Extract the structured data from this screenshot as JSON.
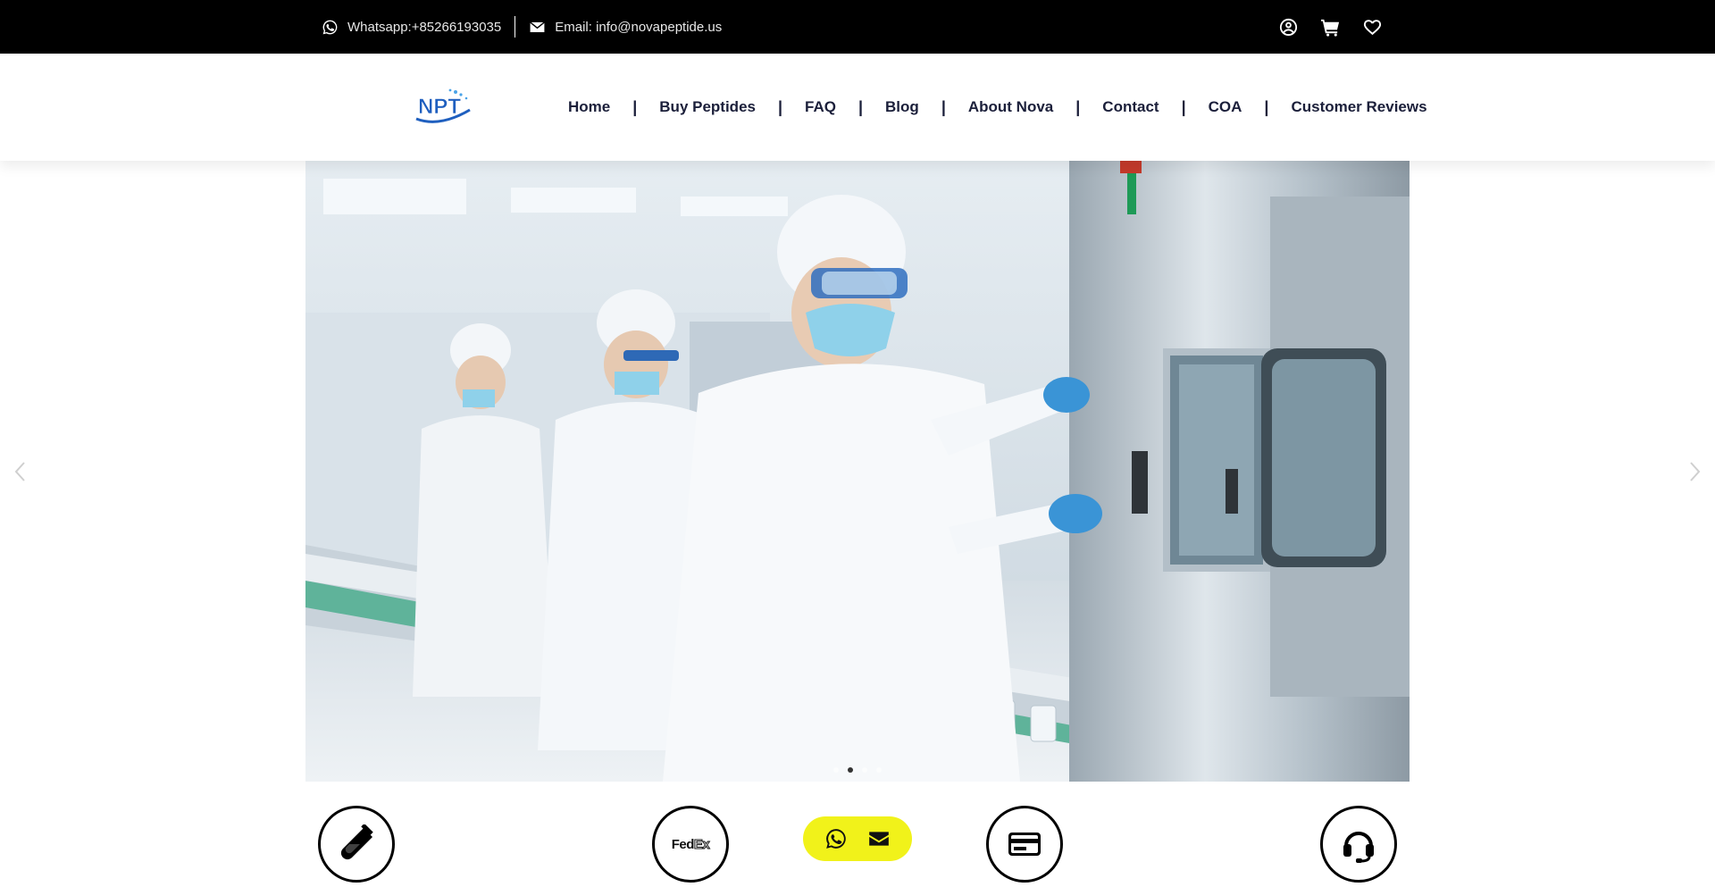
{
  "topbar": {
    "whatsapp": "Whatsapp:+85266193035",
    "email": "Email: info@novapeptide.us",
    "icons": [
      "user-circle-icon",
      "cart-icon",
      "heart-icon"
    ]
  },
  "header": {
    "logo_text": "NPT",
    "nav": [
      {
        "label": "Home"
      },
      {
        "label": "Buy Peptides"
      },
      {
        "label": "FAQ"
      },
      {
        "label": "Blog"
      },
      {
        "label": "About Nova"
      },
      {
        "label": "Contact"
      },
      {
        "label": "COA"
      },
      {
        "label": "Customer Reviews"
      }
    ],
    "separator": "|"
  },
  "hero": {
    "slide_count": 4,
    "active_slide": 2,
    "image": "cleanroom-production-line"
  },
  "features": {
    "items": [
      {
        "icon": "test-tube-icon"
      },
      {
        "icon": "fedex-logo",
        "text_fed": "Fed",
        "text_ex": "Ex"
      },
      {
        "icon": "credit-card-icon"
      },
      {
        "icon": "headset-icon"
      }
    ]
  },
  "floating_contact": {
    "icons": [
      "whatsapp-icon",
      "envelope-icon"
    ],
    "color": "#f1f21a"
  },
  "colors": {
    "topbar_bg": "#000000",
    "nav_text": "#1b1f3a",
    "logo_blue": "#1f5fbf"
  }
}
